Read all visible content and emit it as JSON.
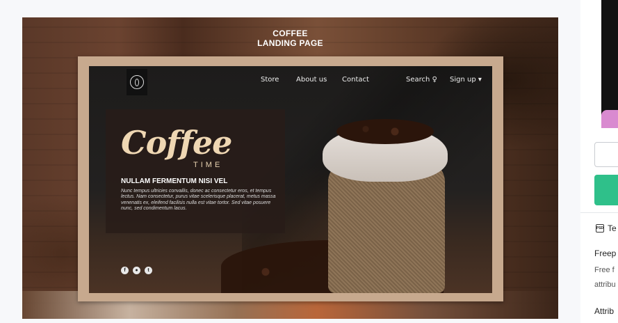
{
  "preview": {
    "title_line1": "COFFEE",
    "title_line2": "LANDING PAGE"
  },
  "mockup": {
    "nav": {
      "store": "Store",
      "about": "About us",
      "contact": "Contact",
      "search": "Search ♀",
      "signup": "Sign up ▾"
    },
    "hero": {
      "script_title": "Coffee",
      "subtitle": "TIME",
      "heading": "NULLAM FERMENTUM NISI VEL",
      "body": "Nunc tempus ultricies convallis, donec ac consectetur eros, et tempus lectus. Nam consectetur, purus vitae scelerisque placerat, metus massa venenatis ex, eleifend facilisis nulla est vitae tortor. Sed vitae posuere nunc, sed condimentum lacus."
    },
    "socials": [
      "f",
      "●",
      "t"
    ]
  },
  "sidebar": {
    "file_type_label": "Te",
    "file_type_icon_text": "PSD",
    "license_title": "Freep",
    "license_line1": "Free f",
    "license_line2": "attribu",
    "attribution_label": "Attrib"
  }
}
